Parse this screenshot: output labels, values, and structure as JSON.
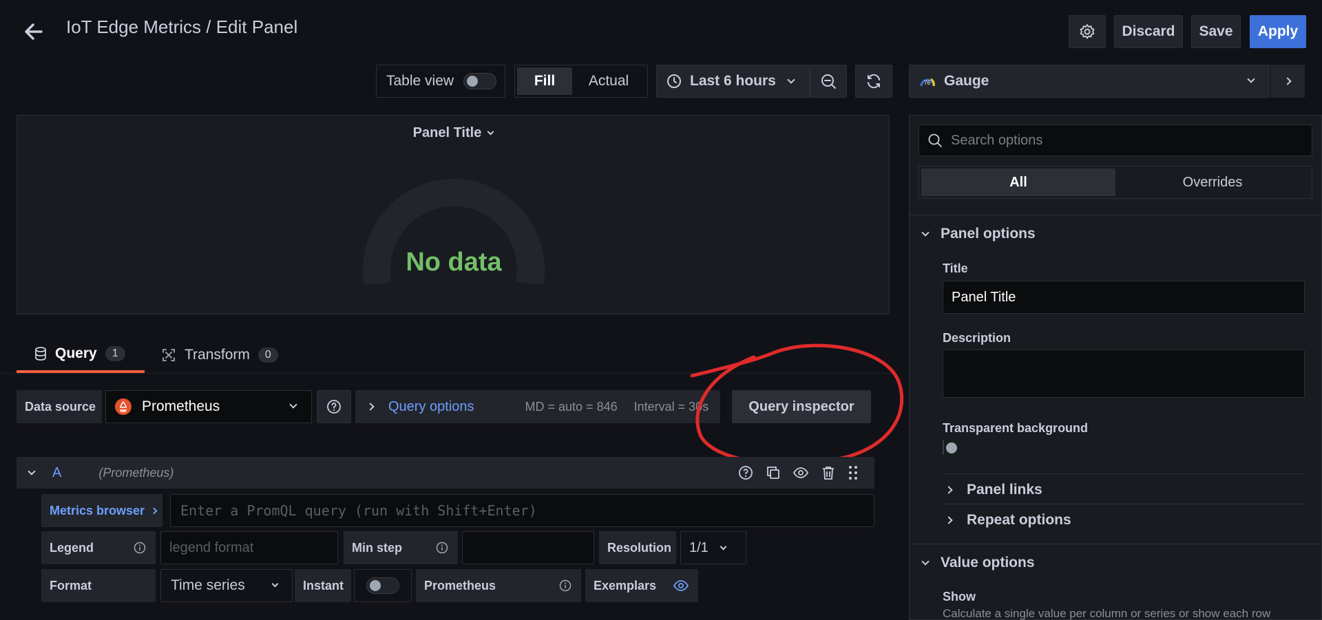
{
  "header": {
    "title": "IoT Edge Metrics / Edit Panel",
    "discard_label": "Discard",
    "save_label": "Save",
    "apply_label": "Apply"
  },
  "toolbar": {
    "table_view_label": "Table view",
    "fill_label": "Fill",
    "actual_label": "Actual",
    "time_range_label": "Last 6 hours",
    "visualization_label": "Gauge",
    "visualization_icon_text": "76"
  },
  "panel": {
    "title": "Panel Title",
    "no_data_text": "No data"
  },
  "tabs": [
    {
      "label": "Query",
      "count": "1"
    },
    {
      "label": "Transform",
      "count": "0"
    }
  ],
  "query_bar": {
    "data_source_label": "Data source",
    "data_source_value": "Prometheus",
    "query_options_label": "Query options",
    "md_text": "MD = auto = 846",
    "interval_text": "Interval = 30s",
    "query_inspector_label": "Query inspector"
  },
  "query_row": {
    "ref_id": "A",
    "datasource_name": "(Prometheus)",
    "metrics_browser_label": "Metrics browser",
    "promql_placeholder": "Enter a PromQL query (run with Shift+Enter)",
    "legend_label": "Legend",
    "legend_placeholder": "legend format",
    "min_step_label": "Min step",
    "resolution_label": "Resolution",
    "resolution_value": "1/1",
    "format_label": "Format",
    "format_value": "Time series",
    "instant_label": "Instant",
    "prometheus_label": "Prometheus",
    "exemplars_label": "Exemplars"
  },
  "options_pane": {
    "search_placeholder": "Search options",
    "tab_all": "All",
    "tab_overrides": "Overrides",
    "panel_options_header": "Panel options",
    "title_label": "Title",
    "title_value": "Panel Title",
    "description_label": "Description",
    "transparent_label": "Transparent background",
    "panel_links_label": "Panel links",
    "repeat_options_label": "Repeat options",
    "value_options_header": "Value options",
    "show_label": "Show",
    "show_description": "Calculate a single value per column or series or show each row"
  },
  "colors": {
    "accent_blue": "#3d71d9",
    "link_blue": "#6e9fff",
    "no_data_green": "#73bf69",
    "tab_underline": "#f55f3e",
    "annotation_red": "#e02b2b"
  }
}
